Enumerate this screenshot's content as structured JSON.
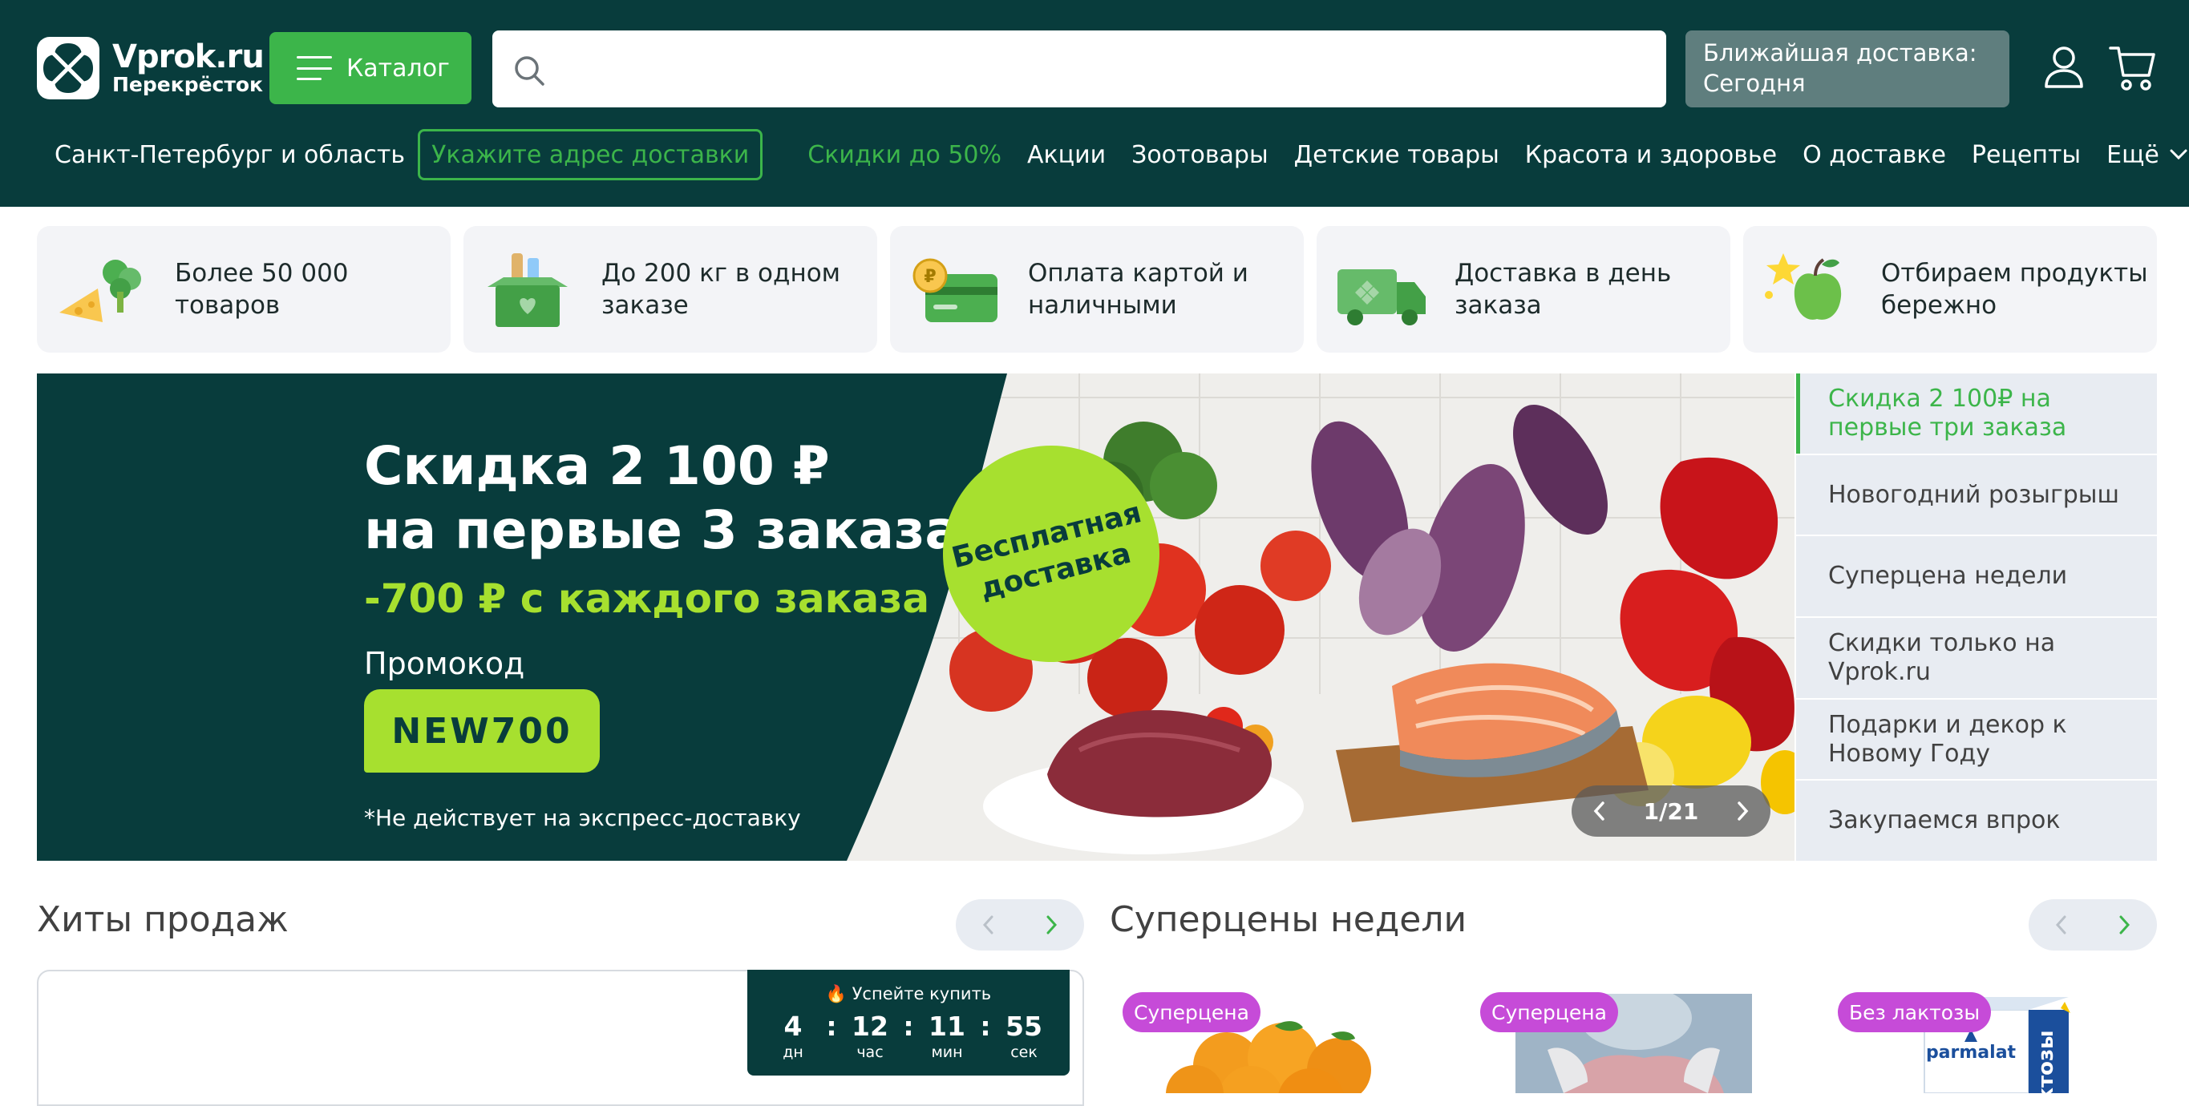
{
  "header": {
    "logo": {
      "title": "Vprok.ru",
      "subtitle": "Перекрёсток"
    },
    "catalog_label": "Каталог",
    "search": {
      "placeholder": "",
      "value": ""
    },
    "delivery": {
      "line1": "Ближайшая доставка:",
      "line2": "Сегодня"
    },
    "icons": {
      "user": "user-icon",
      "cart": "cart-icon",
      "search": "search-icon"
    },
    "city": "Санкт-Петербург и область",
    "address_button": "Укажите адрес доставки",
    "nav": [
      "Скидки до 50%",
      "Акции",
      "Зоотовары",
      "Детские товары",
      "Красота и здоровье",
      "О доставке",
      "Рецепты"
    ],
    "more_label": "Ещё"
  },
  "features": [
    {
      "text": "Более 50 000 товаров",
      "icon": "cheese-broccoli-icon"
    },
    {
      "text": "До 200 кг в одном заказе",
      "icon": "grocery-box-icon"
    },
    {
      "text": "Оплата картой и наличными",
      "icon": "card-coin-icon"
    },
    {
      "text": "Доставка в день заказа",
      "icon": "delivery-truck-icon"
    },
    {
      "text": "Отбираем продукты бережно",
      "icon": "apple-star-icon"
    }
  ],
  "hero": {
    "title_line1": "Скидка 2 100 ₽",
    "title_line2": "на первые 3 заказа",
    "subtitle": "-700 ₽ с каждого заказа",
    "promo_label": "Промокод",
    "promo_code": "NEW700",
    "note": "*Не действует на экспресс-доставку",
    "badge": "Бесплатная доставка",
    "pager": "1/21"
  },
  "promo_list": [
    "Скидка 2 100₽ на первые три заказа",
    "Новогодний розыгрыш",
    "Суперцена недели",
    "Скидки только на Vprok.ru",
    "Подарки и декор к Новому Году",
    "Закупаемся впрок"
  ],
  "hits": {
    "title": "Хиты продаж",
    "timer": {
      "label": "🔥 Успейте купить",
      "days": "4",
      "hours": "12",
      "minutes": "11",
      "seconds": "55",
      "days_unit": "дн",
      "hours_unit": "час",
      "minutes_unit": "мин",
      "seconds_unit": "сек",
      "separator": ":"
    }
  },
  "supercena": {
    "title": "Суперцены недели",
    "products": [
      {
        "badge": "Суперцена",
        "image": "tangerines"
      },
      {
        "badge": "Суперцена",
        "image": "meat-in-hands"
      },
      {
        "badge": "Без лактозы",
        "image": "parmalat-milk",
        "brand": "parmalat",
        "side_text": "ктозы"
      }
    ]
  },
  "colors": {
    "header_bg": "#083c3c",
    "brand_green": "#3cb54a",
    "lime": "#a7e02f",
    "badge_purple": "#c64bd8",
    "promo_item_bg": "#e8ecf2"
  }
}
